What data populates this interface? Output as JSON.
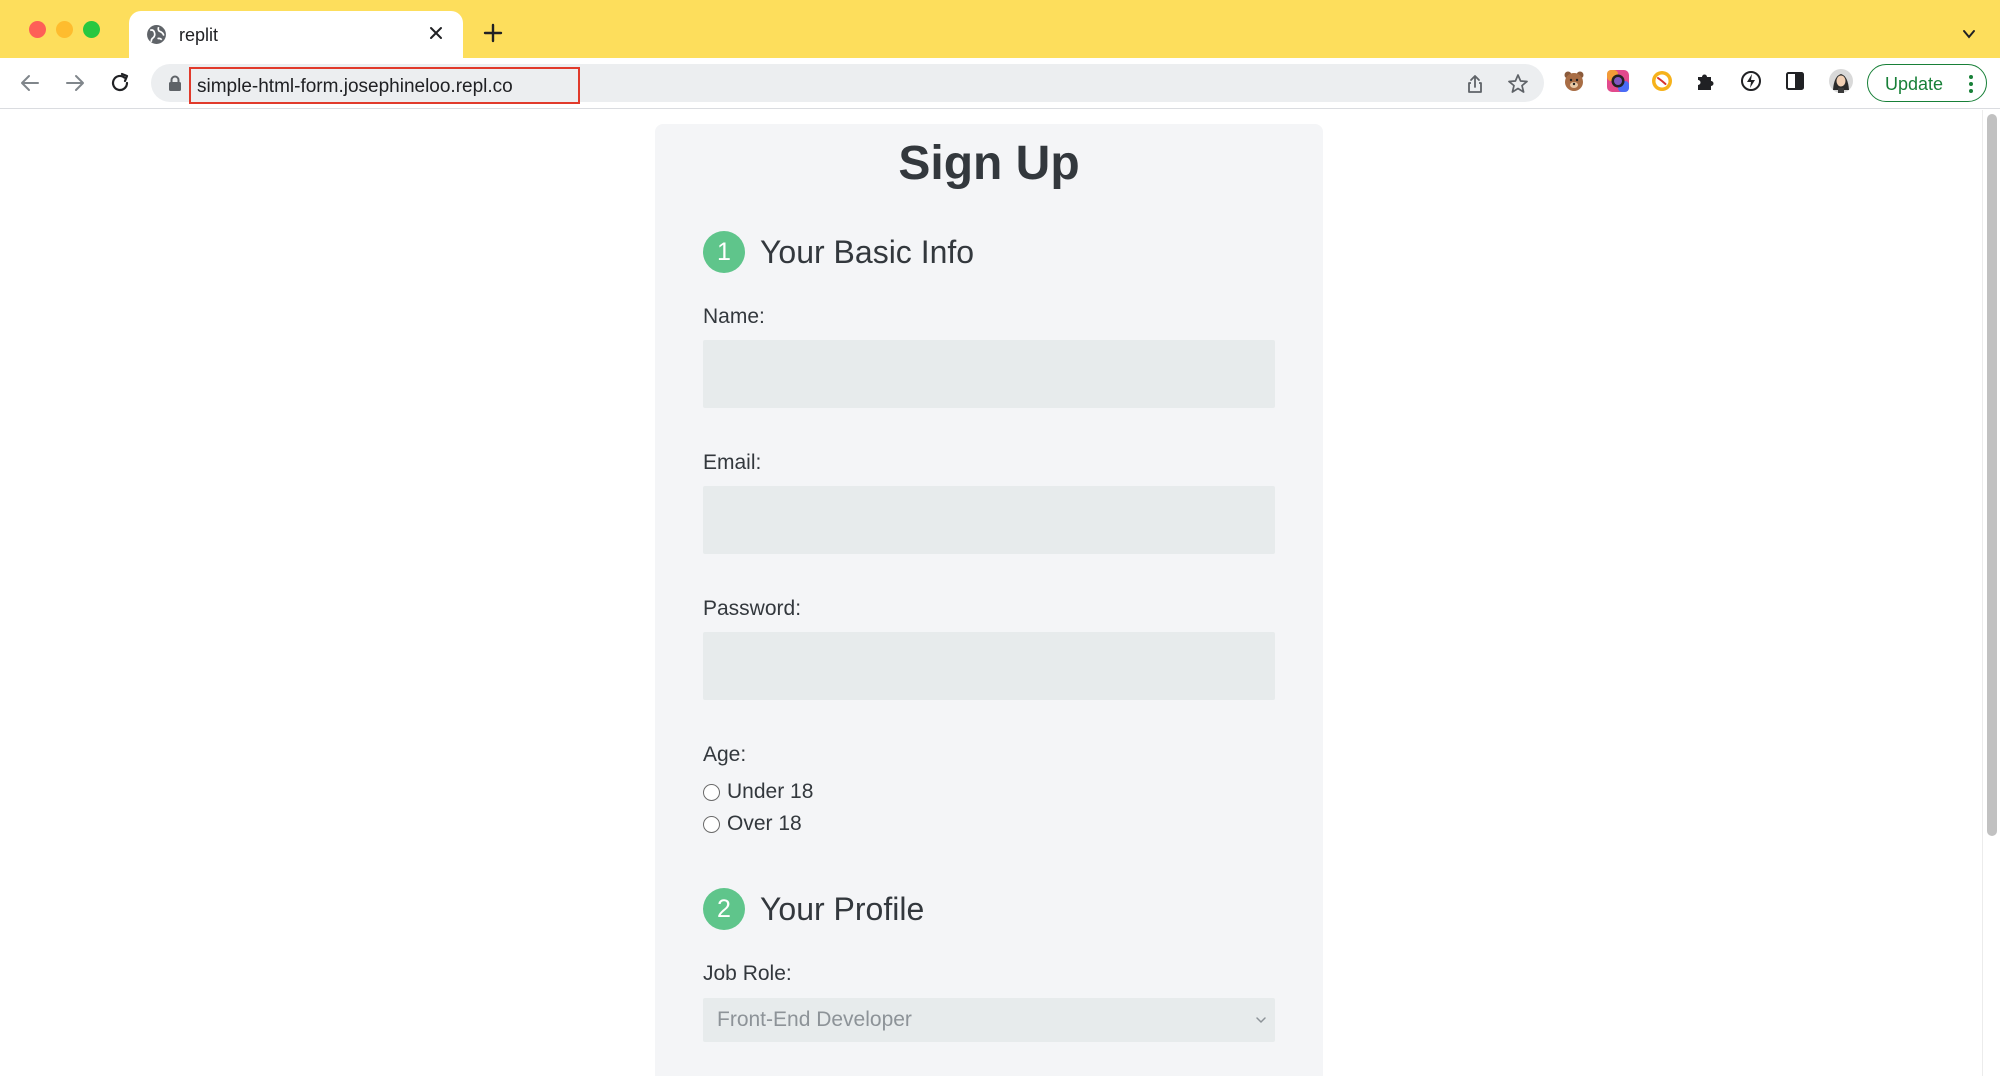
{
  "browser": {
    "tab_title": "replit",
    "url": "simple-html-form.josephineloo.repl.co",
    "update_label": "Update",
    "tab_bar_color": "#fdde5c"
  },
  "form": {
    "title": "Sign Up",
    "section1": {
      "number": "1",
      "title": "Your Basic Info"
    },
    "name_label": "Name:",
    "name_value": "",
    "email_label": "Email:",
    "email_value": "",
    "password_label": "Password:",
    "password_value": "",
    "age_label": "Age:",
    "age_options": [
      "Under 18",
      "Over 18"
    ],
    "section2": {
      "number": "2",
      "title": "Your Profile"
    },
    "job_role_label": "Job Role:",
    "job_role_selected": "Front-End Developer"
  },
  "colors": {
    "step_badge": "#5fc58b",
    "card_bg": "#f4f5f7",
    "field_bg": "#e7ebec",
    "highlight_box": "#e13a2b",
    "update_green": "#188038"
  }
}
